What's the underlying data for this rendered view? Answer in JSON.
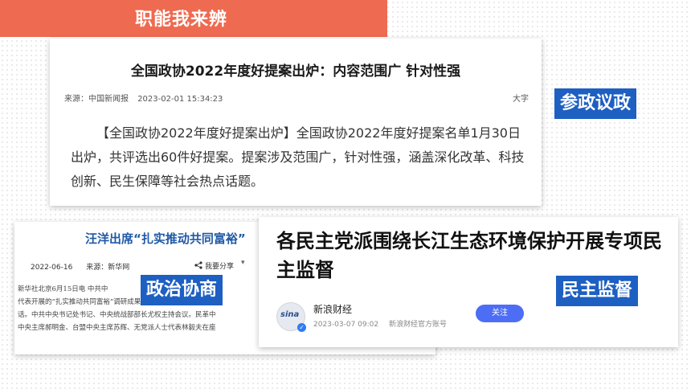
{
  "slide": {
    "title": "职能我来辨"
  },
  "colors": {
    "banner": "#ee6a50",
    "tag": "#1e5fc2",
    "headline_blue": "#1f5aa6",
    "follow_button": "#4d6df5"
  },
  "card1": {
    "headline": "全国政协2022年度好提案出炉：内容范围广 针对性强",
    "source": "来源：中国新闻报",
    "datetime": "2023-02-01 15:34:23",
    "font_size_label": "大字",
    "body": "【全国政协2022年度好提案出炉】全国政协2022年度好提案名单1月30日出炉，共评选出60件好提案。提案涉及范围广，针对性强，涵盖深化改革、科技创新、民生保障等社会热点话题。"
  },
  "card2": {
    "headline": "汪洋出席“扎实推动共同富裕”",
    "date": "2022-06-16",
    "source": "来源：新华网",
    "share_label": "我要分享",
    "share_icon": "share-icon",
    "body_lines": [
      "新华社北京6月15日电  中共中",
      "代表开展的“扎实推动共同富裕”调研成果进行协商。中共中央政",
      "话。中共中央书记处书记、中央统战部部长尤权主持会议。民革中",
      "中央主席郝明金、台盟中央主席苏辉、无党派人士代表林毅夫在座"
    ]
  },
  "card3": {
    "headline": "各民主党派围绕长江生态环境保护开展专项民主监督",
    "logo_text": "sina",
    "source_name": "新浪财经",
    "datetime": "2023-03-07 09:02",
    "account": "新浪财经官方账号",
    "follow_label": "关注"
  },
  "tags": {
    "canzheng": "参政议政",
    "zhengzhi": "政治协商",
    "minzhu": "民主监督"
  }
}
